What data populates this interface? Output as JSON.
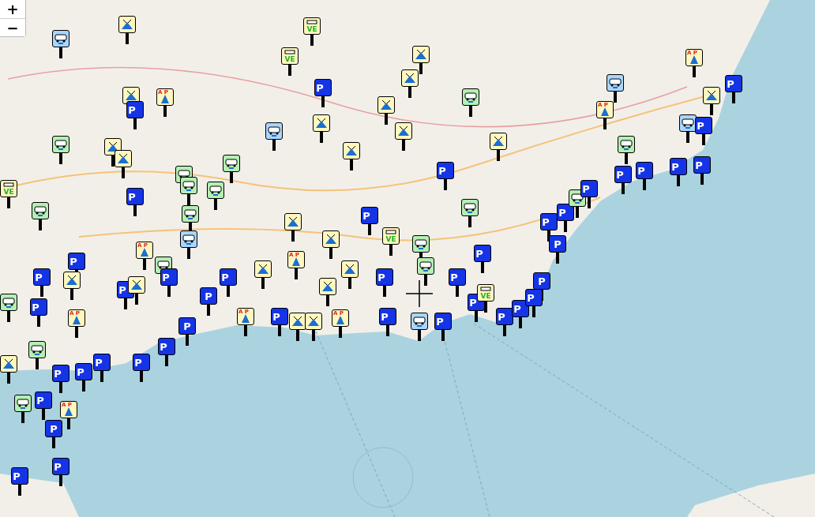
{
  "zoom_controls": {
    "zoom_in": "+",
    "zoom_out": "−"
  },
  "markers": [
    {
      "kind": "camping"
    },
    {
      "kind": "ve",
      "label": "VE"
    },
    {
      "kind": "camper-blue"
    },
    {
      "kind": "camping"
    },
    {
      "kind": "ve",
      "label": "VE"
    },
    {
      "kind": "camping"
    },
    {
      "kind": "night",
      "label": "P"
    },
    {
      "kind": "axp",
      "label": "A P"
    },
    {
      "kind": "camping"
    },
    {
      "kind": "camper-green"
    },
    {
      "kind": "camper-blue"
    },
    {
      "kind": "camping"
    },
    {
      "kind": "camping"
    },
    {
      "kind": "night",
      "label": "P"
    },
    {
      "kind": "camper-blue"
    },
    {
      "kind": "axp",
      "label": "A P"
    },
    {
      "kind": "camper-green"
    },
    {
      "kind": "camping"
    },
    {
      "kind": "camping"
    },
    {
      "kind": "camping"
    },
    {
      "kind": "camper-green"
    },
    {
      "kind": "camping"
    },
    {
      "kind": "camper-green"
    },
    {
      "kind": "night",
      "label": "P"
    },
    {
      "kind": "camper-green"
    },
    {
      "kind": "ve",
      "label": "VE"
    },
    {
      "kind": "night",
      "label": "P"
    },
    {
      "kind": "camper-green"
    },
    {
      "kind": "camper-green"
    },
    {
      "kind": "camper-green"
    },
    {
      "kind": "night",
      "label": "P"
    },
    {
      "kind": "camper-green"
    },
    {
      "kind": "camping"
    },
    {
      "kind": "camping"
    },
    {
      "kind": "night",
      "label": "P"
    },
    {
      "kind": "ve",
      "label": "VE"
    },
    {
      "kind": "camper-green"
    },
    {
      "kind": "night",
      "label": "P"
    },
    {
      "kind": "camper-green"
    },
    {
      "kind": "axp",
      "label": "A P"
    },
    {
      "kind": "camping"
    },
    {
      "kind": "camper-blue"
    },
    {
      "kind": "axp",
      "label": "A P"
    },
    {
      "kind": "camping"
    },
    {
      "kind": "night",
      "label": "P"
    },
    {
      "kind": "night",
      "label": "P"
    },
    {
      "kind": "camping"
    },
    {
      "kind": "night",
      "label": "P"
    },
    {
      "kind": "camper-green"
    },
    {
      "kind": "axp",
      "label": "A P"
    },
    {
      "kind": "night",
      "label": "P"
    },
    {
      "kind": "night",
      "label": "P"
    },
    {
      "kind": "camper-green"
    },
    {
      "kind": "camping"
    },
    {
      "kind": "night",
      "label": "P"
    },
    {
      "kind": "parking",
      "label": "P"
    },
    {
      "kind": "night",
      "label": "P"
    },
    {
      "kind": "camping"
    },
    {
      "kind": "night",
      "label": "P"
    },
    {
      "kind": "axp",
      "label": "A P"
    },
    {
      "kind": "night",
      "label": "P"
    },
    {
      "kind": "camping"
    },
    {
      "kind": "camping"
    },
    {
      "kind": "axp",
      "label": "A P"
    },
    {
      "kind": "night",
      "label": "P"
    },
    {
      "kind": "camper-blue"
    },
    {
      "kind": "night",
      "label": "P"
    },
    {
      "kind": "night",
      "label": "P"
    },
    {
      "kind": "parking",
      "label": "P"
    },
    {
      "kind": "ve",
      "label": "VE"
    },
    {
      "kind": "night",
      "label": "P"
    },
    {
      "kind": "night",
      "label": "P"
    },
    {
      "kind": "parking",
      "label": "P"
    },
    {
      "kind": "night",
      "label": "P"
    },
    {
      "kind": "night",
      "label": "P"
    },
    {
      "kind": "night",
      "label": "P"
    },
    {
      "kind": "camper-green"
    },
    {
      "kind": "night",
      "label": "P"
    },
    {
      "kind": "night",
      "label": "P"
    },
    {
      "kind": "parking",
      "label": "P"
    },
    {
      "kind": "night",
      "label": "P"
    },
    {
      "kind": "camping"
    },
    {
      "kind": "night",
      "label": "P"
    },
    {
      "kind": "night",
      "label": "P"
    },
    {
      "kind": "camper-green"
    },
    {
      "kind": "camper-blue"
    },
    {
      "kind": "axp",
      "label": "A P"
    },
    {
      "kind": "camping"
    },
    {
      "kind": "night",
      "label": "P"
    },
    {
      "kind": "night",
      "label": "P"
    },
    {
      "kind": "camper-green"
    },
    {
      "kind": "night",
      "label": "P"
    },
    {
      "kind": "night",
      "label": "P"
    },
    {
      "kind": "night",
      "label": "P"
    },
    {
      "kind": "night",
      "label": "P"
    },
    {
      "kind": "camping"
    },
    {
      "kind": "axp",
      "label": "A P"
    },
    {
      "kind": "night",
      "label": "P"
    },
    {
      "kind": "parking",
      "label": "P"
    },
    {
      "kind": "camper-green"
    },
    {
      "kind": "night",
      "label": "P"
    },
    {
      "kind": "night",
      "label": "P"
    }
  ]
}
